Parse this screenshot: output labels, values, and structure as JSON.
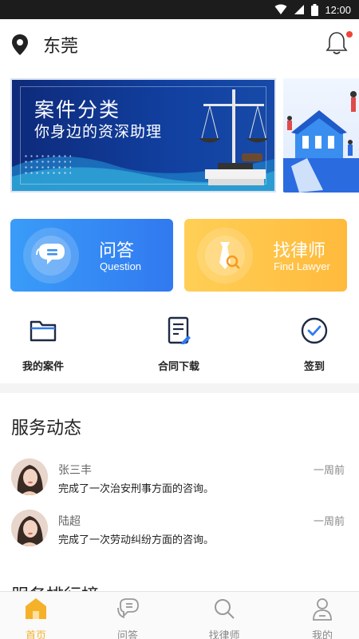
{
  "status_bar": {
    "time": "12:00"
  },
  "header": {
    "city": "东莞"
  },
  "banner": {
    "title": "案件分类",
    "subtitle": "你身边的资深助理"
  },
  "cards": {
    "qa": {
      "title": "问答",
      "subtitle": "Question"
    },
    "lawyer": {
      "title": "找律师",
      "subtitle": "Find Lawyer"
    }
  },
  "quick_actions": [
    {
      "label": "我的案件",
      "icon": "folder-icon"
    },
    {
      "label": "合同下载",
      "icon": "document-icon"
    },
    {
      "label": "签到",
      "icon": "check-circle-icon"
    }
  ],
  "service_feed": {
    "title": "服务动态",
    "items": [
      {
        "name": "张三丰",
        "desc": "完成了一次治安刑事方面的咨询。",
        "time": "一周前"
      },
      {
        "name": "陆超",
        "desc": "完成了一次劳动纠纷方面的咨询。",
        "time": "一周前"
      }
    ]
  },
  "ranking": {
    "title": "服务排行榜"
  },
  "tabbar": {
    "items": [
      {
        "label": "首页",
        "icon": "home-icon",
        "active": true
      },
      {
        "label": "问答",
        "icon": "chat-icon",
        "active": false
      },
      {
        "label": "找律师",
        "icon": "search-icon",
        "active": false
      },
      {
        "label": "我的",
        "icon": "user-icon",
        "active": false
      }
    ]
  },
  "colors": {
    "accent": "#f5b12a",
    "primary_blue": "#3179f0",
    "notification": "#f04438"
  }
}
